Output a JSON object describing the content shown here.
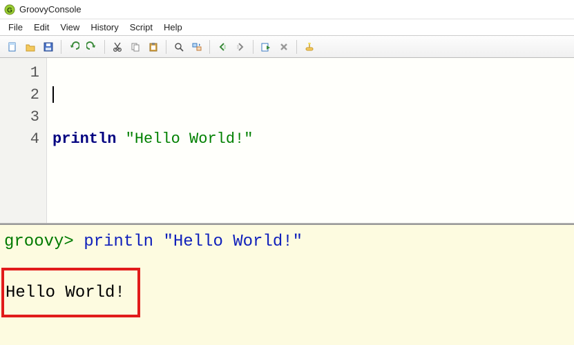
{
  "window": {
    "title": "GroovyConsole"
  },
  "menu": {
    "items": [
      "File",
      "Edit",
      "View",
      "History",
      "Script",
      "Help"
    ]
  },
  "toolbar": {
    "buttons": [
      "new-file",
      "open-file",
      "save-file",
      "|",
      "undo",
      "redo",
      "|",
      "cut",
      "copy",
      "paste",
      "|",
      "find",
      "replace",
      "|",
      "run-prev",
      "run-next",
      "|",
      "run-script",
      "stop-script",
      "|",
      "clear-output"
    ]
  },
  "editor": {
    "lines": {
      "l1": "",
      "l2": "",
      "l3": "",
      "l4_kw": "println",
      "l4_sp": " ",
      "l4_str": "\"Hello World!\""
    },
    "line_numbers": [
      "1",
      "2",
      "3",
      "4"
    ],
    "cursor_line": 2
  },
  "output": {
    "prompt": "groovy> ",
    "echo": "println \"Hello World!\"",
    "result": "Hello World!"
  }
}
